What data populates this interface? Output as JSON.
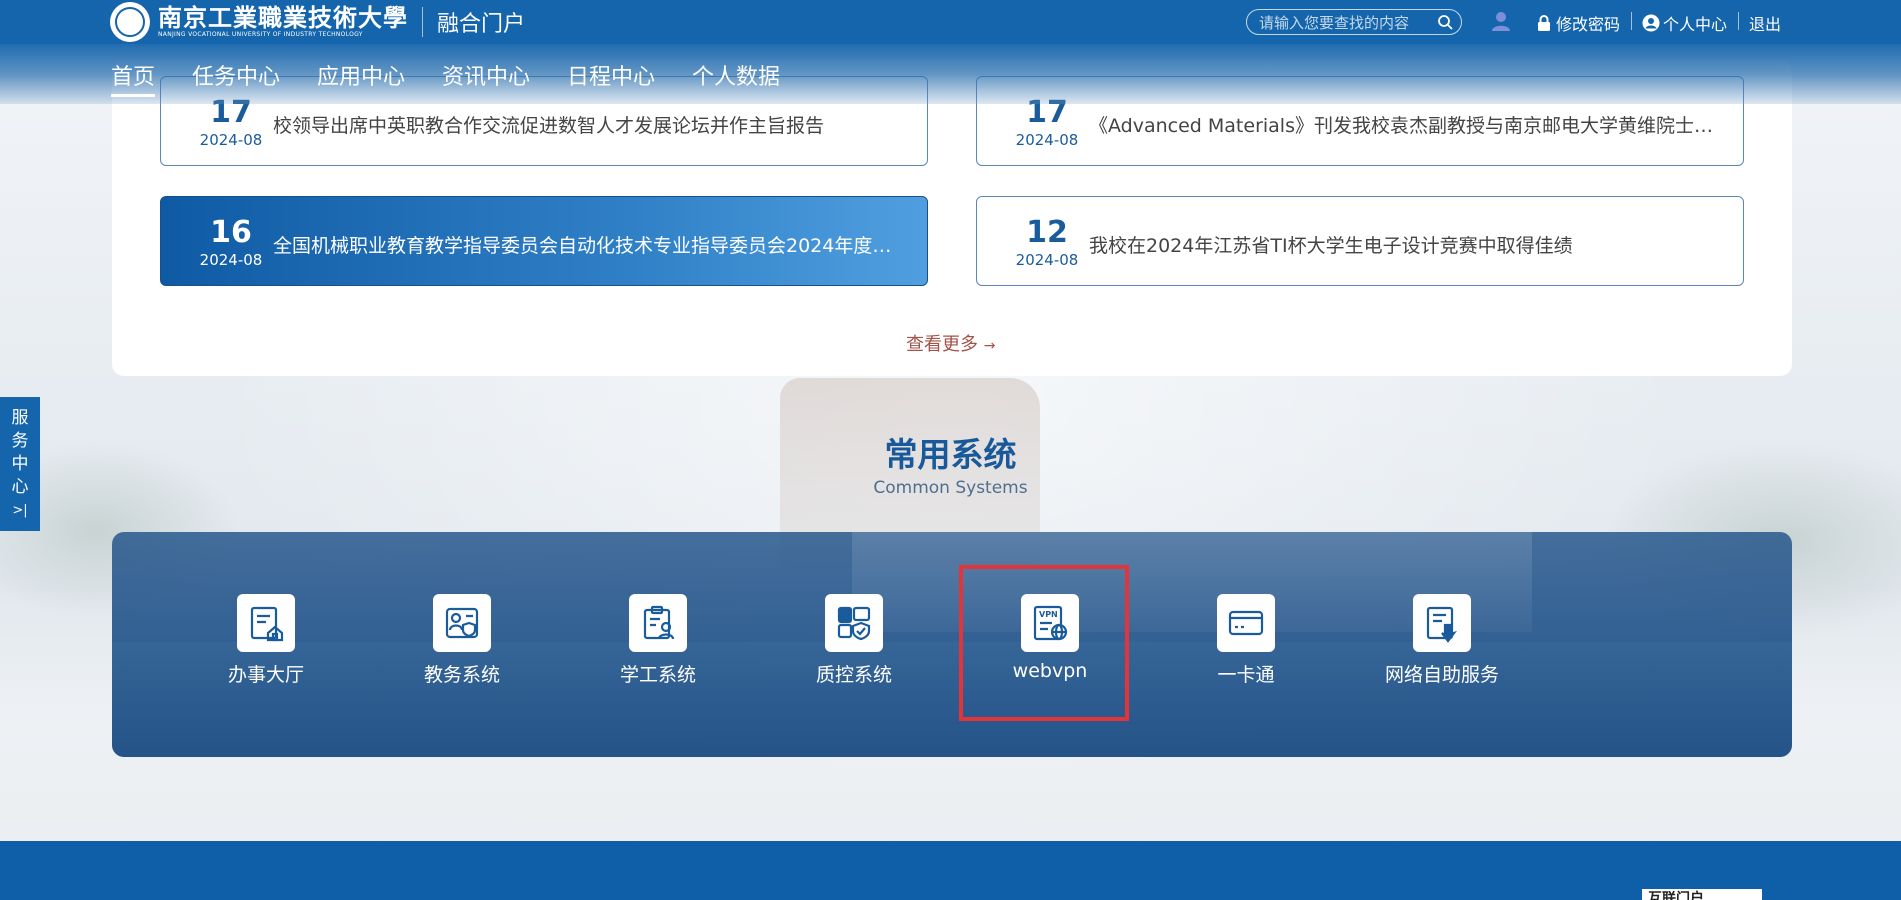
{
  "header": {
    "logo_cn": "南京工業職業技術大學",
    "logo_en": "NANJING VOCATIONAL UNIVERSITY OF INDUSTRY TECHNOLOGY",
    "portal_title": "融合门户",
    "search_placeholder": "请输入您要查找的内容",
    "change_password": "修改密码",
    "personal_center": "个人中心",
    "logout": "退出"
  },
  "nav": {
    "items": [
      "首页",
      "任务中心",
      "应用中心",
      "资讯中心",
      "日程中心",
      "个人数据"
    ]
  },
  "news": {
    "items": [
      {
        "day": "17",
        "date": "2024-08",
        "title": "校领导出席中英职教合作交流促进数智人才发展论坛并作主旨报告"
      },
      {
        "day": "17",
        "date": "2024-08",
        "title": "《Advanced Materials》刊发我校袁杰副教授与南京邮电大学黄维院士…"
      },
      {
        "day": "16",
        "date": "2024-08",
        "title": "全国机械职业教育教学指导委员会自动化技术专业指导委员会2024年度…"
      },
      {
        "day": "12",
        "date": "2024-08",
        "title": "我校在2024年江苏省TI杯大学生电子设计竞赛中取得佳绩"
      }
    ],
    "more": "查看更多"
  },
  "systems": {
    "title": "常用系统",
    "subtitle": "Common Systems",
    "items": [
      {
        "label": "办事大厅",
        "icon": "service-hall-icon"
      },
      {
        "label": "教务系统",
        "icon": "academic-affairs-icon"
      },
      {
        "label": "学工系统",
        "icon": "student-affairs-icon"
      },
      {
        "label": "质控系统",
        "icon": "quality-control-icon"
      },
      {
        "label": "webvpn",
        "icon": "vpn-icon"
      },
      {
        "label": "一卡通",
        "icon": "card-icon"
      },
      {
        "label": "网络自助服务",
        "icon": "network-self-service-icon"
      }
    ]
  },
  "side_tab": {
    "chars": [
      "服",
      "务",
      "中",
      "心"
    ],
    "arrow": ">|"
  },
  "footer": {
    "box_text": "互联门户"
  },
  "colors": {
    "primary": "#1565ad",
    "highlight": "#e3343a",
    "more_link": "#a4524a"
  }
}
